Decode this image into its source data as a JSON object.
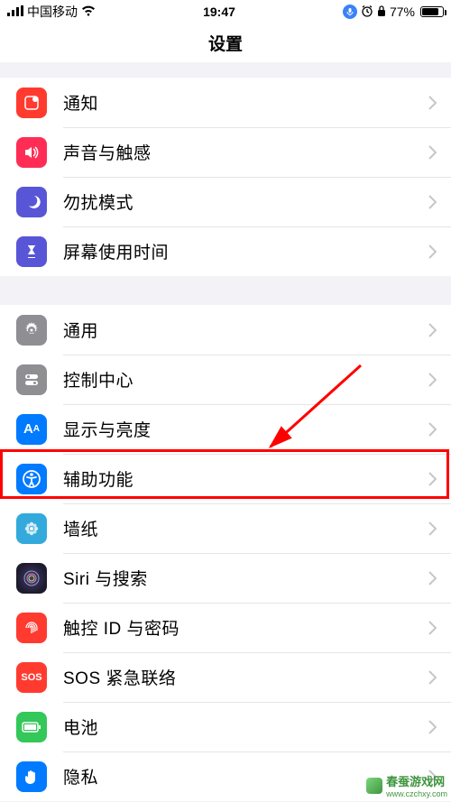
{
  "status": {
    "carrier": "中国移动",
    "time": "19:47",
    "battery_pct": "77%"
  },
  "title": "设置",
  "groups": [
    {
      "items": [
        {
          "key": "notifications",
          "label": "通知",
          "icon": "notifications-icon",
          "color": "#ff3b30"
        },
        {
          "key": "sound",
          "label": "声音与触感",
          "icon": "sound-icon",
          "color": "#ff2d55"
        },
        {
          "key": "dnd",
          "label": "勿扰模式",
          "icon": "moon-icon",
          "color": "#5856d6"
        },
        {
          "key": "screentime",
          "label": "屏幕使用时间",
          "icon": "hourglass-icon",
          "color": "#5856d6"
        }
      ]
    },
    {
      "items": [
        {
          "key": "general",
          "label": "通用",
          "icon": "gear-icon",
          "color": "#8e8e93"
        },
        {
          "key": "controlcenter",
          "label": "控制中心",
          "icon": "toggles-icon",
          "color": "#8e8e93"
        },
        {
          "key": "display",
          "label": "显示与亮度",
          "icon": "aa-icon",
          "color": "#007aff"
        },
        {
          "key": "accessibility",
          "label": "辅助功能",
          "icon": "accessibility-icon",
          "color": "#007aff",
          "highlighted": true
        },
        {
          "key": "wallpaper",
          "label": "墙纸",
          "icon": "flower-icon",
          "color": "#34aadc"
        },
        {
          "key": "siri",
          "label": "Siri 与搜索",
          "icon": "siri-icon",
          "color": "#1c1c1e"
        },
        {
          "key": "touchid",
          "label": "触控 ID 与密码",
          "icon": "fingerprint-icon",
          "color": "#ff3b30"
        },
        {
          "key": "sos",
          "label": "SOS 紧急联络",
          "icon": "sos-icon",
          "color": "#ff3b30"
        },
        {
          "key": "battery",
          "label": "电池",
          "icon": "battery-icon",
          "color": "#34c759"
        },
        {
          "key": "privacy",
          "label": "隐私",
          "icon": "hand-icon",
          "color": "#007aff"
        }
      ]
    }
  ],
  "watermark": {
    "text1": "春蚕游戏网",
    "text2": "www.czchxy.com"
  }
}
